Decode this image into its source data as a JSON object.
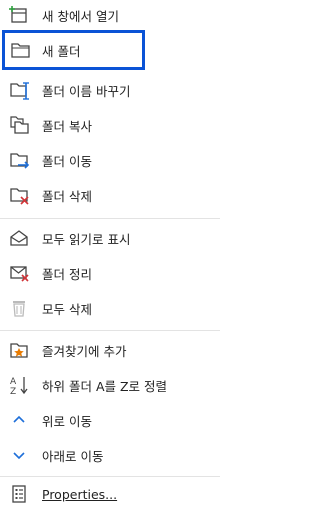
{
  "menu": {
    "items": [
      {
        "label": "새 창에서 열기",
        "icon": "open-new-window-icon"
      },
      {
        "label": "새 폴더",
        "icon": "new-folder-icon"
      },
      {
        "label": "폴더 이름 바꾸기",
        "icon": "rename-folder-icon"
      },
      {
        "label": "폴더 복사",
        "icon": "copy-folder-icon"
      },
      {
        "label": "폴더 이동",
        "icon": "move-folder-icon"
      },
      {
        "label": "폴더 삭제",
        "icon": "delete-folder-icon"
      },
      {
        "label": "모두 읽기로 표시",
        "icon": "mark-all-read-icon"
      },
      {
        "label": "폴더 정리",
        "icon": "clean-up-folder-icon"
      },
      {
        "label": "모두 삭제",
        "icon": "delete-all-icon"
      },
      {
        "label": "즐겨찾기에 추가",
        "icon": "add-to-favorites-icon"
      },
      {
        "label": "하위 폴더 A를 Z로 정렬",
        "icon": "sort-az-icon"
      },
      {
        "label": "위로 이동",
        "icon": "chevron-up-icon"
      },
      {
        "label": "아래로 이동",
        "icon": "chevron-down-icon"
      },
      {
        "label": "Properties...",
        "icon": "properties-icon"
      }
    ]
  },
  "colors": {
    "accent": "#0a53d6",
    "delete_red": "#d13438",
    "star_orange": "#e87b00",
    "icon_gray": "#444444",
    "arrow_blue": "#1e6fd9"
  }
}
